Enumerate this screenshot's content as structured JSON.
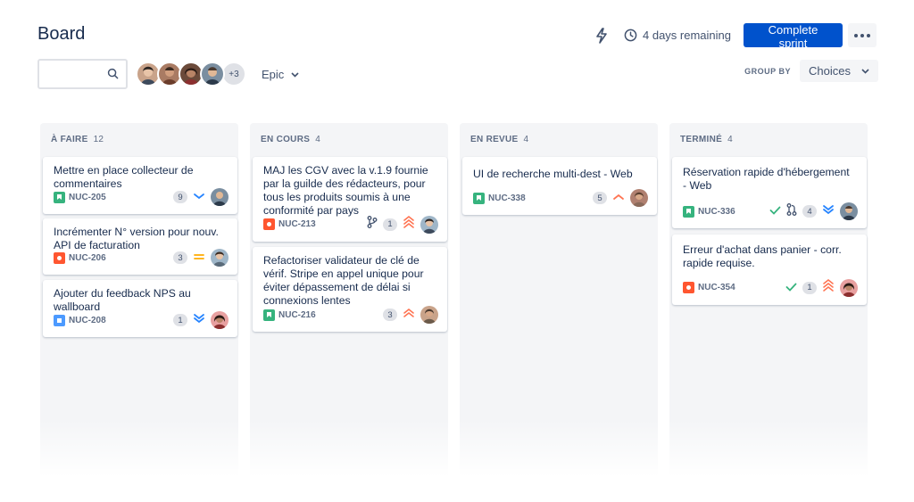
{
  "header": {
    "title": "Board",
    "remaining": "4 days remaining",
    "complete_label": "Complete sprint"
  },
  "filters": {
    "search_placeholder": "",
    "more_avatars": "+3",
    "epic_label": "Epic",
    "group_by_label": "GROUP BY",
    "choices_label": "Choices"
  },
  "columns": [
    {
      "title": "À FAIRE",
      "count": "12",
      "cards": [
        {
          "summary": "Mettre en place collecteur de commentaires",
          "key": "NUC-205",
          "type": "story",
          "estimate": "9",
          "priority": "low"
        },
        {
          "summary": "Incrémenter N° version pour nouv. API de facturation",
          "key": "NUC-206",
          "type": "bug",
          "estimate": "3",
          "priority": "medium"
        },
        {
          "summary": "Ajouter du feedback NPS au wallboard",
          "key": "NUC-208",
          "type": "task",
          "estimate": "1",
          "priority": "lowest"
        }
      ]
    },
    {
      "title": "EN COURS",
      "count": "4",
      "cards": [
        {
          "summary": "MAJ les CGV avec la v.1.9 fournie par la guilde des rédacteurs, pour tous les produits soumis à une conformité par pays",
          "key": "NUC-213",
          "type": "bug",
          "estimate": "1",
          "priority": "highest"
        },
        {
          "summary": "Refactoriser validateur de clé de vérif. Stripe en appel unique pour éviter dépassement de délai si connexions lentes",
          "key": "NUC-216",
          "type": "story",
          "estimate": "3",
          "priority": "high"
        }
      ]
    },
    {
      "title": "EN REVUE",
      "count": "4",
      "cards": [
        {
          "summary": "UI de recherche multi-dest - Web",
          "key": "NUC-338",
          "type": "story",
          "estimate": "5",
          "priority": "medium-high"
        }
      ]
    },
    {
      "title": "TERMINÉ",
      "count": "4",
      "cards": [
        {
          "summary": "Réservation rapide d'hébergement - Web",
          "key": "NUC-336",
          "type": "story",
          "estimate": "4",
          "priority": "lowest"
        },
        {
          "summary": "Erreur d'achat dans panier - corr. rapide requise.",
          "key": "NUC-354",
          "type": "bug",
          "estimate": "1",
          "priority": "highest"
        }
      ]
    }
  ],
  "colors": {
    "primary": "#0052cc",
    "story": "#36b37e",
    "bug": "#ff5630",
    "task": "#4c9aff",
    "priority_high": "#ff7452",
    "priority_low": "#2684ff",
    "priority_medium": "#ffab00",
    "done_check": "#36b37e"
  }
}
